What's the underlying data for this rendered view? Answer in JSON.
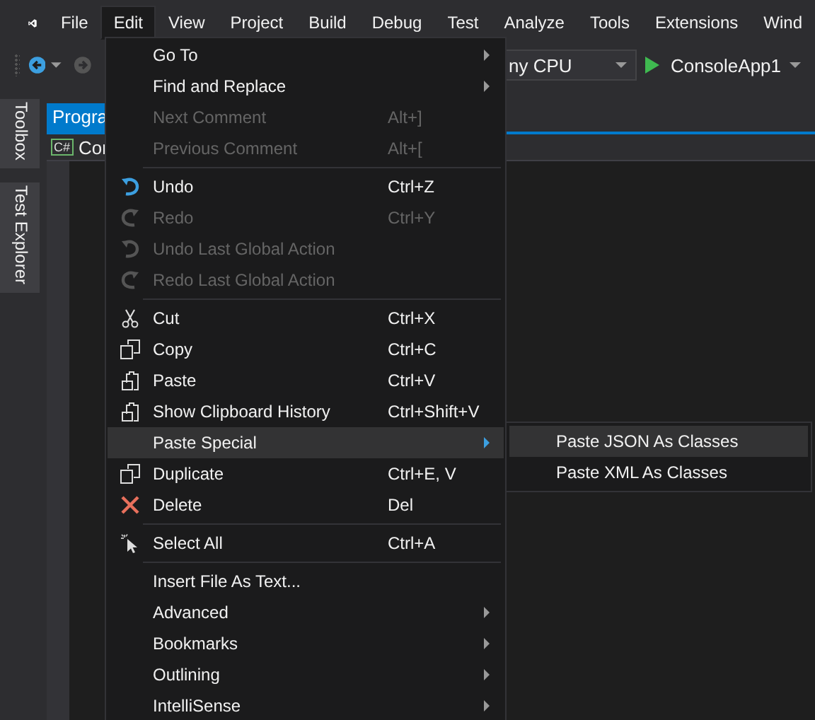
{
  "menu_bar": [
    {
      "label": "File",
      "selected": false
    },
    {
      "label": "Edit",
      "selected": true
    },
    {
      "label": "View",
      "selected": false
    },
    {
      "label": "Project",
      "selected": false
    },
    {
      "label": "Build",
      "selected": false
    },
    {
      "label": "Debug",
      "selected": false
    },
    {
      "label": "Test",
      "selected": false
    },
    {
      "label": "Analyze",
      "selected": false
    },
    {
      "label": "Tools",
      "selected": false
    },
    {
      "label": "Extensions",
      "selected": false
    },
    {
      "label": "Wind",
      "selected": false
    }
  ],
  "toolbar": {
    "platform": "ny CPU",
    "start_target": "ConsoleApp1"
  },
  "side_tabs": [
    "Toolbox",
    "Test Explorer"
  ],
  "document_tab": {
    "label": "Progra",
    "selected": true
  },
  "navigation_bar": {
    "badge": "C#",
    "label": "Cor"
  },
  "edit_menu": [
    {
      "kind": "plain",
      "label": "Go To",
      "submenu": true,
      "disabled": false,
      "selected": false
    },
    {
      "kind": "plain",
      "label": "Find and Replace",
      "submenu": true,
      "disabled": false,
      "selected": false
    },
    {
      "kind": "plain",
      "label": "Next Comment",
      "shortcut": "Alt+]",
      "disabled": true,
      "selected": false
    },
    {
      "kind": "plain",
      "label": "Previous Comment",
      "shortcut": "Alt+[",
      "disabled": true,
      "selected": false
    },
    {
      "kind": "separator"
    },
    {
      "kind": "undo",
      "label": "Undo",
      "shortcut": "Ctrl+Z",
      "disabled": false,
      "selected": false
    },
    {
      "kind": "redo",
      "label": "Redo",
      "shortcut": "Ctrl+Y",
      "disabled": true,
      "selected": false
    },
    {
      "kind": "undo",
      "label": "Undo Last Global Action",
      "disabled": true,
      "selected": false
    },
    {
      "kind": "redo",
      "label": "Redo Last Global Action",
      "disabled": true,
      "selected": false
    },
    {
      "kind": "separator"
    },
    {
      "kind": "cut",
      "label": "Cut",
      "shortcut": "Ctrl+X",
      "disabled": false,
      "selected": false
    },
    {
      "kind": "copy",
      "label": "Copy",
      "shortcut": "Ctrl+C",
      "disabled": false,
      "selected": false
    },
    {
      "kind": "paste",
      "label": "Paste",
      "shortcut": "Ctrl+V",
      "disabled": false,
      "selected": false
    },
    {
      "kind": "paste",
      "label": "Show Clipboard History",
      "shortcut": "Ctrl+Shift+V",
      "disabled": false,
      "selected": false
    },
    {
      "kind": "plain",
      "label": "Paste Special",
      "submenu": true,
      "disabled": false,
      "selected": true
    },
    {
      "kind": "copy",
      "label": "Duplicate",
      "shortcut": "Ctrl+E, V",
      "disabled": false,
      "selected": false
    },
    {
      "kind": "delete",
      "label": "Delete",
      "shortcut": "Del",
      "disabled": false,
      "selected": false
    },
    {
      "kind": "separator"
    },
    {
      "kind": "select",
      "label": "Select All",
      "shortcut": "Ctrl+A",
      "disabled": false,
      "selected": false
    },
    {
      "kind": "separator"
    },
    {
      "kind": "plain",
      "label": "Insert File As Text...",
      "disabled": false,
      "selected": false
    },
    {
      "kind": "plain",
      "label": "Advanced",
      "submenu": true,
      "disabled": false,
      "selected": false
    },
    {
      "kind": "plain",
      "label": "Bookmarks",
      "submenu": true,
      "disabled": false,
      "selected": false
    },
    {
      "kind": "plain",
      "label": "Outlining",
      "submenu": true,
      "disabled": false,
      "selected": false
    },
    {
      "kind": "plain",
      "label": "IntelliSense",
      "submenu": true,
      "disabled": false,
      "selected": false
    }
  ],
  "paste_special_menu": [
    {
      "label": "Paste JSON As Classes",
      "selected": true
    },
    {
      "label": "Paste XML As Classes",
      "selected": false
    }
  ]
}
